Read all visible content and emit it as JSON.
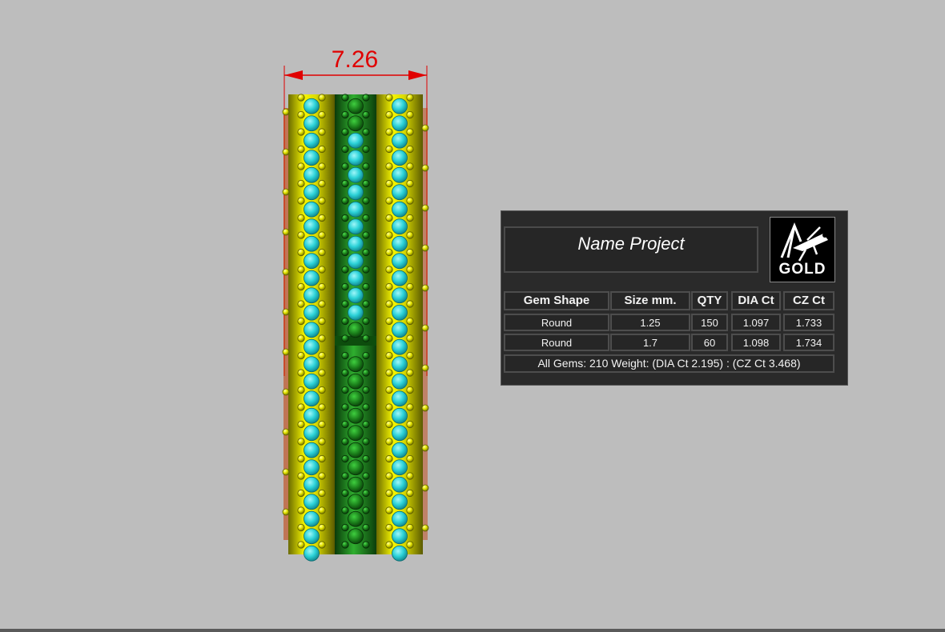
{
  "dimension": {
    "value": "7.26"
  },
  "panel": {
    "title": "Name Project",
    "logo_text": "GOLD",
    "table": {
      "headers": [
        "Gem Shape",
        "Size mm.",
        "QTY",
        "DIA Ct",
        "CZ Ct"
      ],
      "rows": [
        [
          "Round",
          "1.25",
          "150",
          "1.097",
          "1.733"
        ],
        [
          "Round",
          "1.7",
          "60",
          "1.098",
          "1.734"
        ]
      ]
    },
    "summary": "All Gems: 210  Weight: (DIA Ct 2.195) : (CZ Ct 3.468)"
  },
  "colors": {
    "background": "#bdbdbd",
    "dimension": "#e00000",
    "gold": "#e6e600",
    "gem": "#29d0d6",
    "green_metal": "#1f8a1f"
  }
}
